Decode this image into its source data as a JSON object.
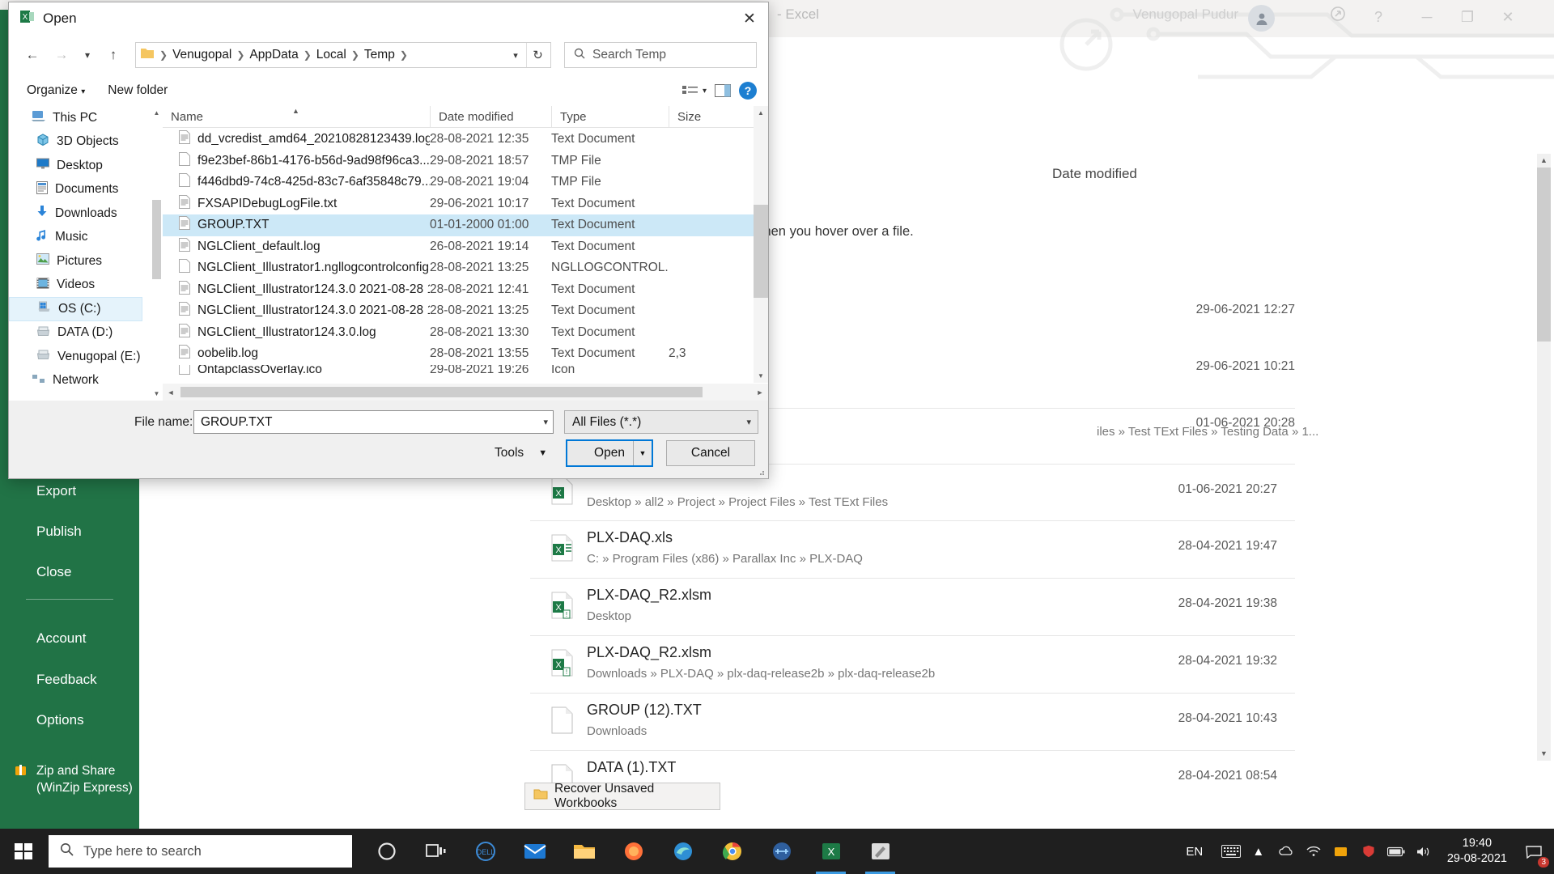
{
  "excel": {
    "title_suffix": "- Excel",
    "user_name": "Venugopal Pudur",
    "window_controls": {
      "minimize": "─",
      "maximize": "❐",
      "close": "✕"
    },
    "backstage_items": [
      "Export",
      "Publish",
      "Close",
      "Account",
      "Feedback",
      "Options"
    ],
    "zip_share_label": "Zip and Share (WinZip Express)",
    "recent_header": "Date modified",
    "pin_hint": "e pin icon that appears when you hover over a file.",
    "recover_button": "Recover Unsaved Workbooks",
    "bare_dates": [
      "29-06-2021 12:27",
      "29-06-2021 10:21",
      "01-06-2021 20:28"
    ],
    "recent_files": [
      {
        "name": "",
        "path": "iles » Test TExt Files » Testing Data » 1...",
        "date": ""
      },
      {
        "name": "",
        "path": "Desktop » all2 » Project » Project Files » Test TExt Files",
        "date": "01-06-2021 20:27"
      },
      {
        "name": "PLX-DAQ.xls",
        "path": "C: » Program Files (x86) » Parallax Inc » PLX-DAQ",
        "date": "28-04-2021 19:47"
      },
      {
        "name": "PLX-DAQ_R2.xlsm",
        "path": "Desktop",
        "date": "28-04-2021 19:38"
      },
      {
        "name": "PLX-DAQ_R2.xlsm",
        "path": "Downloads » PLX-DAQ » plx-daq-release2b » plx-daq-release2b",
        "date": "28-04-2021 19:32"
      },
      {
        "name": "GROUP (12).TXT",
        "path": "Downloads",
        "date": "28-04-2021 10:43"
      },
      {
        "name": "DATA (1).TXT",
        "path": "",
        "date": "28-04-2021 08:54"
      }
    ]
  },
  "dialog": {
    "title": "Open",
    "app_icon": "excel-icon",
    "close_label": "✕",
    "breadcrumbs": [
      "Venugopal",
      "AppData",
      "Local",
      "Temp"
    ],
    "search": {
      "placeholder": "Search Temp",
      "value": ""
    },
    "toolbar": {
      "organize": "Organize",
      "new_folder": "New folder",
      "help": "?"
    },
    "nav_items": [
      {
        "label": "This PC",
        "icon": "pc-icon",
        "selected": false,
        "indent": 0
      },
      {
        "label": "3D Objects",
        "icon": "cube-icon",
        "selected": false,
        "indent": 1
      },
      {
        "label": "Desktop",
        "icon": "desktop-icon",
        "selected": false,
        "indent": 1
      },
      {
        "label": "Documents",
        "icon": "documents-icon",
        "selected": false,
        "indent": 1
      },
      {
        "label": "Downloads",
        "icon": "download-icon",
        "selected": false,
        "indent": 1
      },
      {
        "label": "Music",
        "icon": "music-icon",
        "selected": false,
        "indent": 1
      },
      {
        "label": "Pictures",
        "icon": "pictures-icon",
        "selected": false,
        "indent": 1
      },
      {
        "label": "Videos",
        "icon": "videos-icon",
        "selected": false,
        "indent": 1
      },
      {
        "label": "OS (C:)",
        "icon": "drive-icon",
        "selected": true,
        "indent": 1
      },
      {
        "label": "DATA (D:)",
        "icon": "drive-icon",
        "selected": false,
        "indent": 1
      },
      {
        "label": "Venugopal (E:)",
        "icon": "drive-icon",
        "selected": false,
        "indent": 1
      },
      {
        "label": "Network",
        "icon": "network-icon",
        "selected": false,
        "indent": 0
      }
    ],
    "columns": [
      "Name",
      "Date modified",
      "Type",
      "Size"
    ],
    "files": [
      {
        "name": "dd_vcredist_amd64_20210828123439.log",
        "date": "28-08-2021 12:35",
        "type": "Text Document",
        "size": "",
        "icon": "text-file-icon",
        "selected": false
      },
      {
        "name": "f9e23bef-86b1-4176-b56d-9ad98f96ca3...",
        "date": "29-08-2021 18:57",
        "type": "TMP File",
        "size": "",
        "icon": "blank-file-icon",
        "selected": false
      },
      {
        "name": "f446dbd9-74c8-425d-83c7-6af35848c79...",
        "date": "29-08-2021 19:04",
        "type": "TMP File",
        "size": "",
        "icon": "blank-file-icon",
        "selected": false
      },
      {
        "name": "FXSAPIDebugLogFile.txt",
        "date": "29-06-2021 10:17",
        "type": "Text Document",
        "size": "",
        "icon": "text-file-icon",
        "selected": false
      },
      {
        "name": "GROUP.TXT",
        "date": "01-01-2000 01:00",
        "type": "Text Document",
        "size": "",
        "icon": "text-file-icon",
        "selected": true
      },
      {
        "name": "NGLClient_default.log",
        "date": "26-08-2021 19:14",
        "type": "Text Document",
        "size": "",
        "icon": "text-file-icon",
        "selected": false
      },
      {
        "name": "NGLClient_Illustrator1.ngllogcontrolconfig",
        "date": "28-08-2021 13:25",
        "type": "NGLLOGCONTROL...",
        "size": "",
        "icon": "blank-file-icon",
        "selected": false
      },
      {
        "name": "NGLClient_Illustrator124.3.0 2021-08-28 1...",
        "date": "28-08-2021 12:41",
        "type": "Text Document",
        "size": "",
        "icon": "text-file-icon",
        "selected": false
      },
      {
        "name": "NGLClient_Illustrator124.3.0 2021-08-28 1...",
        "date": "28-08-2021 13:25",
        "type": "Text Document",
        "size": "",
        "icon": "text-file-icon",
        "selected": false
      },
      {
        "name": "NGLClient_Illustrator124.3.0.log",
        "date": "28-08-2021 13:30",
        "type": "Text Document",
        "size": "",
        "icon": "text-file-icon",
        "selected": false
      },
      {
        "name": "oobelib.log",
        "date": "28-08-2021 13:55",
        "type": "Text Document",
        "size": "2,3",
        "icon": "text-file-icon",
        "selected": false
      },
      {
        "name": "OntapclassOverlay.ico",
        "date": "29-08-2021 19:26",
        "type": "Icon",
        "size": "",
        "icon": "blank-file-icon",
        "selected": false
      }
    ],
    "footer": {
      "file_name_label": "File name:",
      "file_name_value": "GROUP.TXT",
      "filter_value": "All Files (*.*)",
      "tools_label": "Tools",
      "open_label": "Open",
      "cancel_label": "Cancel"
    }
  },
  "taskbar": {
    "search_placeholder": "Type here to search",
    "apps": [
      "cortana-icon",
      "task-view-icon",
      "dell-icon",
      "mail-icon",
      "file-explorer-icon",
      "firefox-icon",
      "edge-icon",
      "chrome-icon",
      "arduino-icon",
      "excel-icon",
      "paint-icon"
    ],
    "language": "EN",
    "clock_time": "19:40",
    "clock_date": "29-08-2021",
    "notification_count": "3"
  },
  "colors": {
    "excel_green": "#217346",
    "accent_blue": "#0078d7",
    "selection_blue": "#cce8f7",
    "taskbar": "#1f1f1f"
  }
}
